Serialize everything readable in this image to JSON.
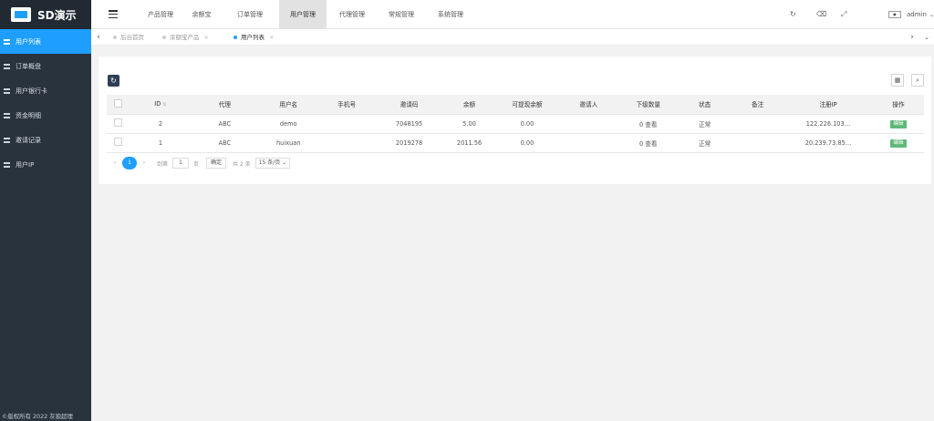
{
  "app": {
    "title": "SD演示",
    "footer": "©版权所有 2022 灰狼超理"
  },
  "sidebar": {
    "items": [
      {
        "label": "用户列表",
        "icon": "users-icon"
      },
      {
        "label": "订单概盘",
        "icon": "list-icon"
      },
      {
        "label": "用户银行卡",
        "icon": "list-icon"
      },
      {
        "label": "资金明细",
        "icon": "list-icon"
      },
      {
        "label": "邀请记录",
        "icon": "list-icon"
      },
      {
        "label": "用户IP",
        "icon": "list-icon"
      }
    ]
  },
  "topnav": {
    "tabs": [
      "产品管理",
      "余额宝",
      "订单管理",
      "用户管理",
      "代理管理",
      "常规管理",
      "系统管理"
    ],
    "active": "用户管理"
  },
  "user": {
    "name": "admin"
  },
  "pagetabs": [
    {
      "label": "后台首页"
    },
    {
      "label": "余额宝产品"
    },
    {
      "label": "用户列表"
    }
  ],
  "table": {
    "headers": [
      "ID",
      "代理",
      "用户名",
      "手机号",
      "邀请码",
      "余额",
      "可提现余额",
      "邀请人",
      "下级数量",
      "状态",
      "备注",
      "注册IP",
      "操作"
    ],
    "rows": [
      {
        "id": "2",
        "agent": "ABC",
        "username": "demo",
        "phone": "",
        "invite": "7048195",
        "balance": "5.00",
        "withdrawable": "0.00",
        "inviter": "",
        "sub": "0 查看",
        "status": "正常",
        "remark": "",
        "ip": "122.226.103…",
        "action": "编辑"
      },
      {
        "id": "1",
        "agent": "ABC",
        "username": "huixuan",
        "phone": "",
        "invite": "2019278",
        "balance": "2011.56",
        "withdrawable": "0.00",
        "inviter": "",
        "sub": "0 查看",
        "status": "正常",
        "remark": "",
        "ip": "20.239.73.85…",
        "action": "编辑"
      }
    ]
  },
  "pager": {
    "prev": "‹",
    "current": "1",
    "next": "›",
    "goto_label": "到第",
    "page_value": "1",
    "page_unit": "页",
    "confirm": "确定",
    "total": "共 2 条",
    "per_page": "15 条/页"
  }
}
